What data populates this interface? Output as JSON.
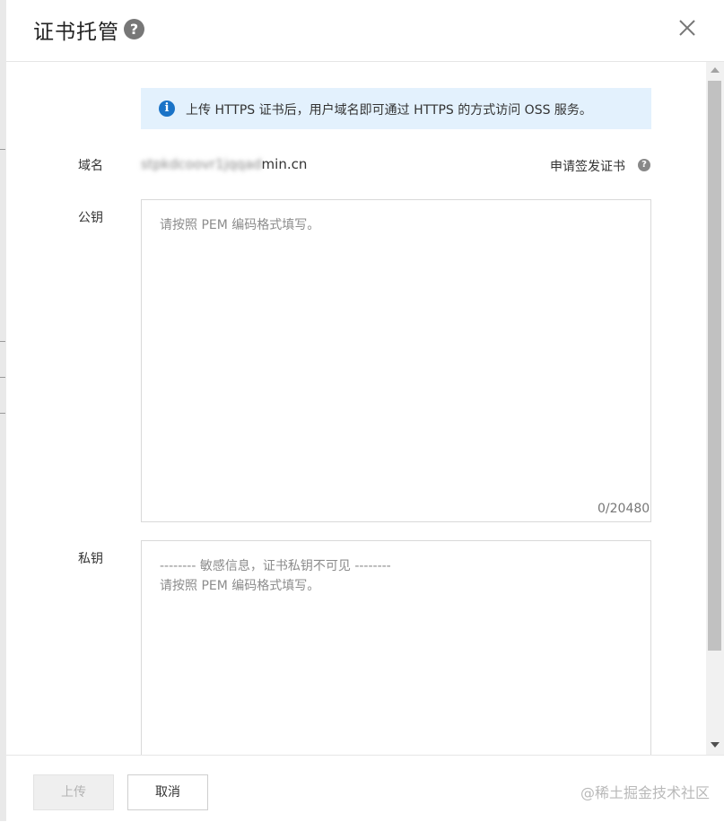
{
  "dialog": {
    "title": "证书托管",
    "help_glyph": "?"
  },
  "notice": {
    "icon": "info-icon",
    "glyph": "i",
    "text": "上传 HTTPS 证书后，用户域名即可通过 HTTPS 的方式访问 OSS 服务。"
  },
  "domain": {
    "label": "域名",
    "value_obscured": "stpkdcoovr1jqqad",
    "value_suffix": "min.cn",
    "apply_link": "申请签发证书",
    "help_glyph": "?"
  },
  "public_key": {
    "label": "公钥",
    "placeholder": "请按照 PEM 编码格式填写。",
    "counter": "0/20480"
  },
  "private_key": {
    "label": "私钥",
    "placeholder": "-------- 敏感信息，证书私钥不可见 --------\n请按照 PEM 编码格式填写。"
  },
  "footer": {
    "upload_label": "上传",
    "cancel_label": "取消",
    "watermark": "@稀土掘金技术社区"
  },
  "colors": {
    "info_bg": "#e3f1fd",
    "info_icon": "#1a73c7",
    "disabled_button_bg": "#efefef",
    "border": "#d9d9d9"
  }
}
